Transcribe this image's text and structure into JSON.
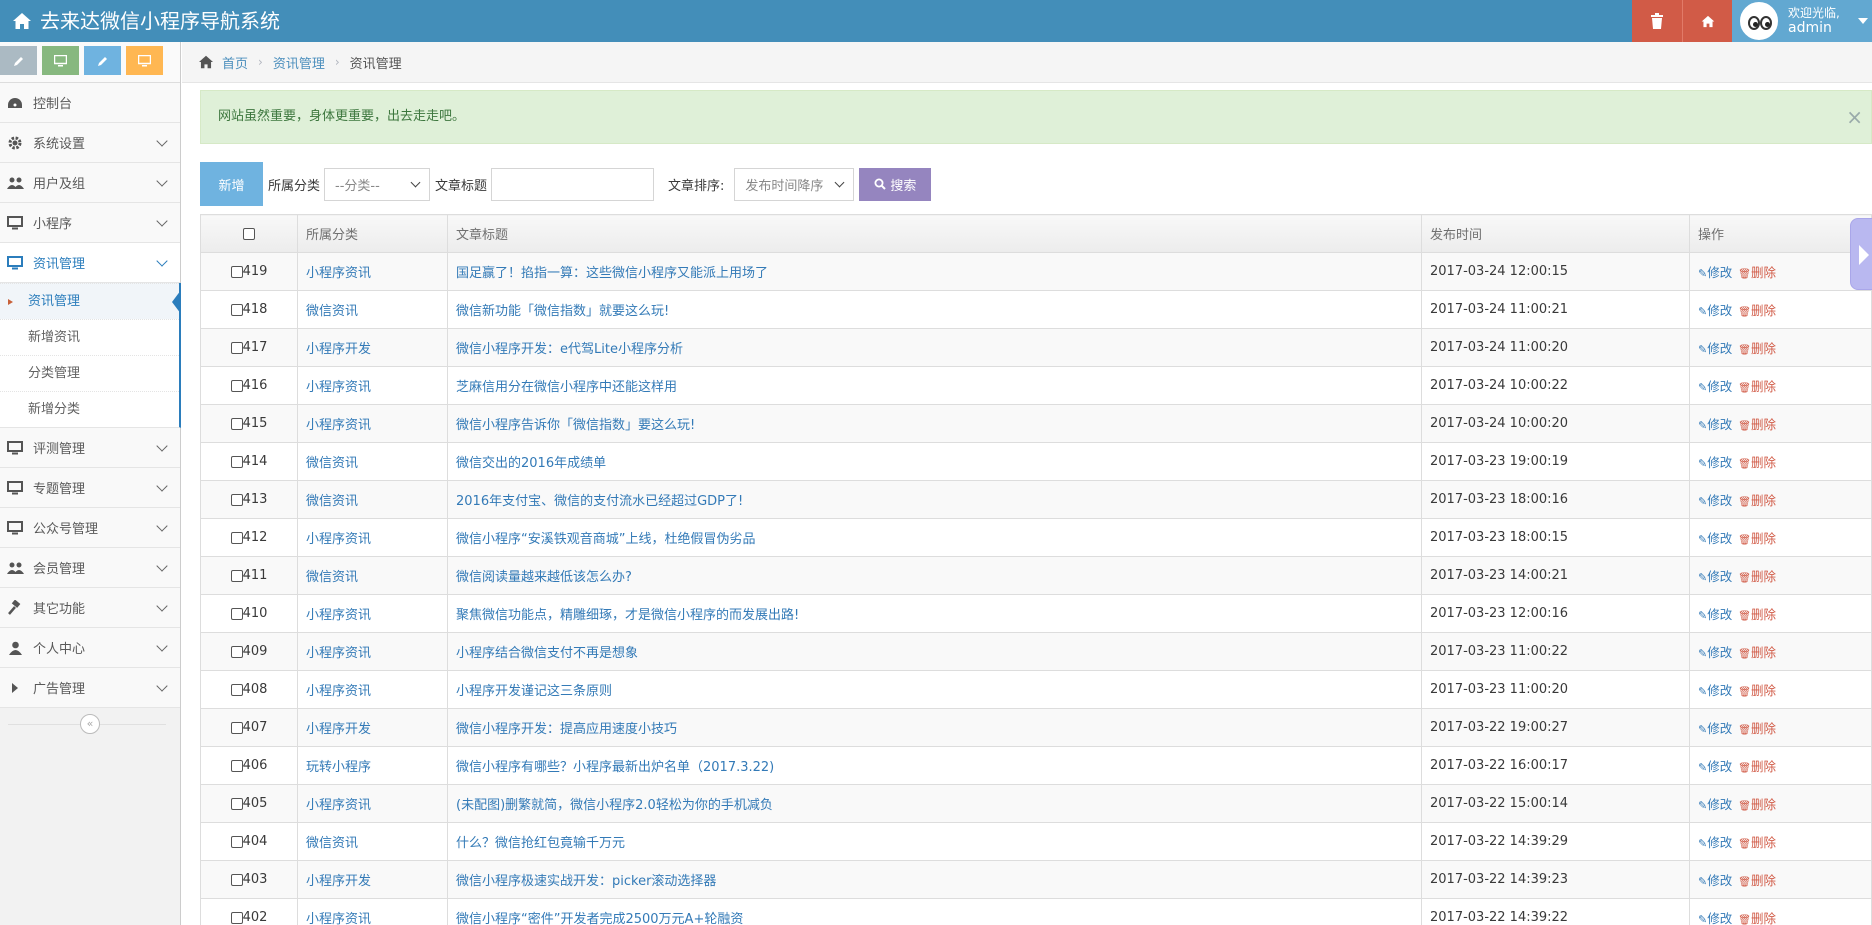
{
  "app": {
    "title": "去来达微信小程序导航系统",
    "welcome": "欢迎光临,",
    "user": "admin"
  },
  "sidebar": {
    "menu": [
      {
        "label": "控制台",
        "icon": "dashboard-icon"
      },
      {
        "label": "系统设置",
        "icon": "gear-icon"
      },
      {
        "label": "用户及组",
        "icon": "users-icon"
      },
      {
        "label": "小程序",
        "icon": "desktop-icon"
      },
      {
        "label": "资讯管理",
        "icon": "desktop-icon",
        "active": true
      },
      {
        "label": "评测管理",
        "icon": "desktop-icon"
      },
      {
        "label": "专题管理",
        "icon": "desktop-icon"
      },
      {
        "label": "公众号管理",
        "icon": "desktop-icon"
      },
      {
        "label": "会员管理",
        "icon": "users-icon"
      },
      {
        "label": "其它功能",
        "icon": "gavel-icon"
      },
      {
        "label": "个人中心",
        "icon": "user-icon"
      },
      {
        "label": "广告管理",
        "icon": "caret-right-icon"
      }
    ],
    "submenu": [
      "资讯管理",
      "新增资讯",
      "分类管理",
      "新增分类"
    ],
    "collapse": "«"
  },
  "breadcrumb": {
    "home": "首页",
    "parent": "资讯管理",
    "current": "资讯管理"
  },
  "alert": {
    "text": "网站虽然重要，身体更重要，出去走走吧。",
    "close": "×"
  },
  "toolbar": {
    "new_label": "新增",
    "category_label": "所属分类",
    "category_value": "--分类--",
    "title_label": "文章标题",
    "sort_label": "文章排序:",
    "sort_value": "发布时间降序",
    "search_label": "搜索"
  },
  "table": {
    "headers": [
      "所属分类",
      "文章标题",
      "发布时间",
      "操作"
    ],
    "edit_label": "修改",
    "delete_label": "删除",
    "rows": [
      {
        "id": "419",
        "cat": "小程序资讯",
        "title": "国足赢了！掐指一算：这些微信小程序又能派上用场了",
        "time": "2017-03-24 12:00:15"
      },
      {
        "id": "418",
        "cat": "微信资讯",
        "title": "微信新功能「微信指数」就要这么玩!",
        "time": "2017-03-24 11:00:21"
      },
      {
        "id": "417",
        "cat": "小程序开发",
        "title": "微信小程序开发：e代驾Lite小程序分析",
        "time": "2017-03-24 11:00:20"
      },
      {
        "id": "416",
        "cat": "小程序资讯",
        "title": "芝麻信用分在微信小程序中还能这样用",
        "time": "2017-03-24 10:00:22"
      },
      {
        "id": "415",
        "cat": "小程序资讯",
        "title": "微信小程序告诉你「微信指数」要这么玩!",
        "time": "2017-03-24 10:00:20"
      },
      {
        "id": "414",
        "cat": "微信资讯",
        "title": "微信交出的2016年成绩单",
        "time": "2017-03-23 19:00:19"
      },
      {
        "id": "413",
        "cat": "微信资讯",
        "title": "2016年支付宝、微信的支付流水已经超过GDP了!",
        "time": "2017-03-23 18:00:16"
      },
      {
        "id": "412",
        "cat": "小程序资讯",
        "title": "微信小程序“安溪铁观音商城”上线，杜绝假冒伪劣品",
        "time": "2017-03-23 18:00:15"
      },
      {
        "id": "411",
        "cat": "微信资讯",
        "title": "微信阅读量越来越低该怎么办?",
        "time": "2017-03-23 14:00:21"
      },
      {
        "id": "410",
        "cat": "小程序资讯",
        "title": "聚焦微信功能点，精雕细琢，才是微信小程序的而发展出路!",
        "time": "2017-03-23 12:00:16"
      },
      {
        "id": "409",
        "cat": "小程序资讯",
        "title": "小程序结合微信支付不再是想象",
        "time": "2017-03-23 11:00:22"
      },
      {
        "id": "408",
        "cat": "小程序资讯",
        "title": "小程序开发谨记这三条原则",
        "time": "2017-03-23 11:00:20"
      },
      {
        "id": "407",
        "cat": "小程序开发",
        "title": "微信小程序开发：提高应用速度小技巧",
        "time": "2017-03-22 19:00:27"
      },
      {
        "id": "406",
        "cat": "玩转小程序",
        "title": "微信小程序有哪些？小程序最新出炉名单（2017.3.22)",
        "time": "2017-03-22 16:00:17"
      },
      {
        "id": "405",
        "cat": "小程序资讯",
        "title": "(未配图)删繁就简，微信小程序2.0轻松为你的手机减负",
        "time": "2017-03-22 15:00:14"
      },
      {
        "id": "404",
        "cat": "微信资讯",
        "title": "什么？微信抢红包竟输千万元",
        "time": "2017-03-22 14:39:29"
      },
      {
        "id": "403",
        "cat": "小程序开发",
        "title": "微信小程序极速实战开发：picker滚动选择器",
        "time": "2017-03-22 14:39:23"
      },
      {
        "id": "402",
        "cat": "小程序资讯",
        "title": "微信小程序“密件”开发者完成2500万元A+轮融资",
        "time": "2017-03-22 14:39:22"
      }
    ]
  }
}
